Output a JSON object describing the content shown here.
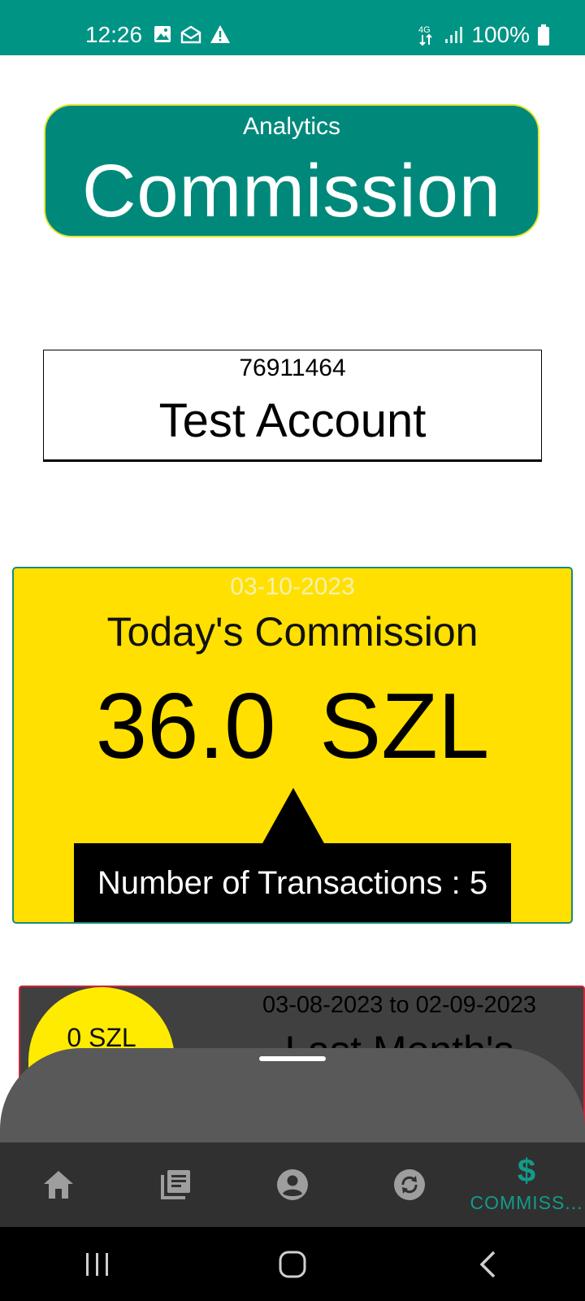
{
  "status_bar": {
    "time": "12:26",
    "battery": "100%",
    "network": "4G",
    "icons": [
      "image-icon",
      "mail-icon",
      "warning-icon",
      "data-arrows-icon",
      "signal-icon",
      "battery-icon"
    ],
    "background": "#009485"
  },
  "header": {
    "subtitle": "Analytics",
    "title": "Commission"
  },
  "account": {
    "number": "76911464",
    "name": "Test Account"
  },
  "today": {
    "date": "03-10-2023",
    "title": "Today's Commission",
    "amount": "36.0  SZL",
    "tooltip": "Number of Transactions : 5",
    "background": "#ffe000"
  },
  "last_month": {
    "badge": "0 SZL",
    "range": "03-08-2023 to 02-09-2023",
    "title": "Last Month's"
  },
  "bottom_nav": {
    "items": [
      {
        "icon": "home-icon",
        "label": ""
      },
      {
        "icon": "list-icon",
        "label": ""
      },
      {
        "icon": "account-icon",
        "label": ""
      },
      {
        "icon": "sync-icon",
        "label": ""
      },
      {
        "icon": "dollar-icon",
        "label": "COMMISS...",
        "active": true
      }
    ],
    "active_color": "#139b8a"
  },
  "system_nav": {
    "buttons": [
      "recents-button",
      "home-button",
      "back-button"
    ]
  }
}
